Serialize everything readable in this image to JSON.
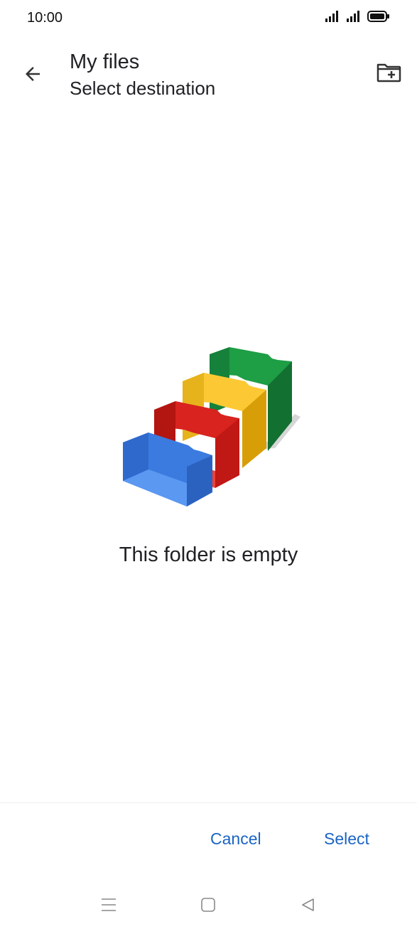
{
  "status_bar": {
    "time": "10:00",
    "icons": [
      "signal-icon",
      "signal-icon",
      "battery-icon"
    ]
  },
  "app_bar": {
    "back_icon": "arrow-back-icon",
    "title": "My files",
    "subtitle": "Select destination",
    "new_folder_icon": "create-new-folder-icon"
  },
  "empty_state": {
    "illustration": "stacked-folders-illustration",
    "message": "This folder is empty"
  },
  "actions": {
    "cancel_label": "Cancel",
    "select_label": "Select"
  },
  "nav_bar": {
    "items": [
      "menu-icon",
      "home-icon",
      "back-triangle-icon"
    ]
  },
  "colors": {
    "accent": "#1a64c4",
    "text": "#202124",
    "folder_blue": "#3b7be0",
    "folder_red": "#d8231f",
    "folder_yellow": "#fcc934",
    "folder_green": "#1e9e45"
  }
}
